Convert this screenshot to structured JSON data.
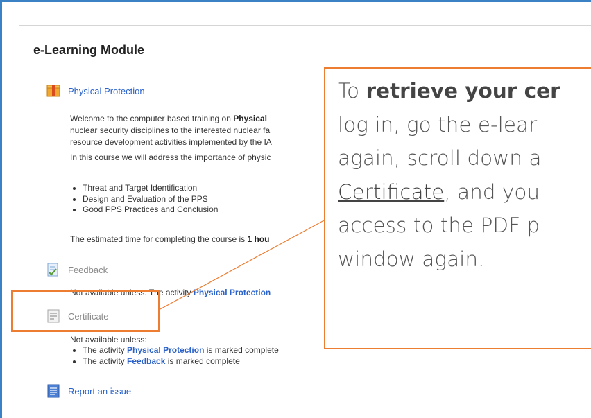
{
  "module": {
    "title": "e-Learning Module"
  },
  "activities": {
    "physical_protection": "Physical Protection",
    "feedback": "Feedback",
    "certificate": "Certificate",
    "report": "Report an issue"
  },
  "intro": {
    "line1_prefix": "Welcome to the computer based training on ",
    "line1_bold": "Physical",
    "line2": "nuclear security disciplines to the interested nuclear fa",
    "line3": "resource development activities implemented by the IA",
    "line4": "In this course we will address the importance of physic",
    "bullets": [
      "Threat and Target Identification",
      "Design and Evaluation of the PPS",
      "Good PPS Practices and Conclusion"
    ],
    "estimate_prefix": "The estimated time for completing the course is ",
    "estimate_bold": "1 hou"
  },
  "feedback_restriction": {
    "prefix": "Not available unless: The activity ",
    "link": "Physical Protection"
  },
  "certificate_restriction": {
    "heading": "Not available unless:",
    "items": [
      {
        "prefix": "The activity ",
        "link": "Physical Protection",
        "suffix": " is marked complete"
      },
      {
        "prefix": "The activity ",
        "link": "Feedback",
        "suffix": " is marked complete"
      }
    ]
  },
  "callout": {
    "t1": "To ",
    "t1_bold": "retrieve your cer",
    "t2": "log in, go the e-lear",
    "t3": "again, scroll down a",
    "t4_u": "Certificate",
    "t4_rest": ", and you",
    "t5": "access to the PDF p",
    "t6": "window again."
  },
  "colors": {
    "accent": "#ec7d31",
    "link": "#2a62c9",
    "frame": "#3b82c4"
  }
}
